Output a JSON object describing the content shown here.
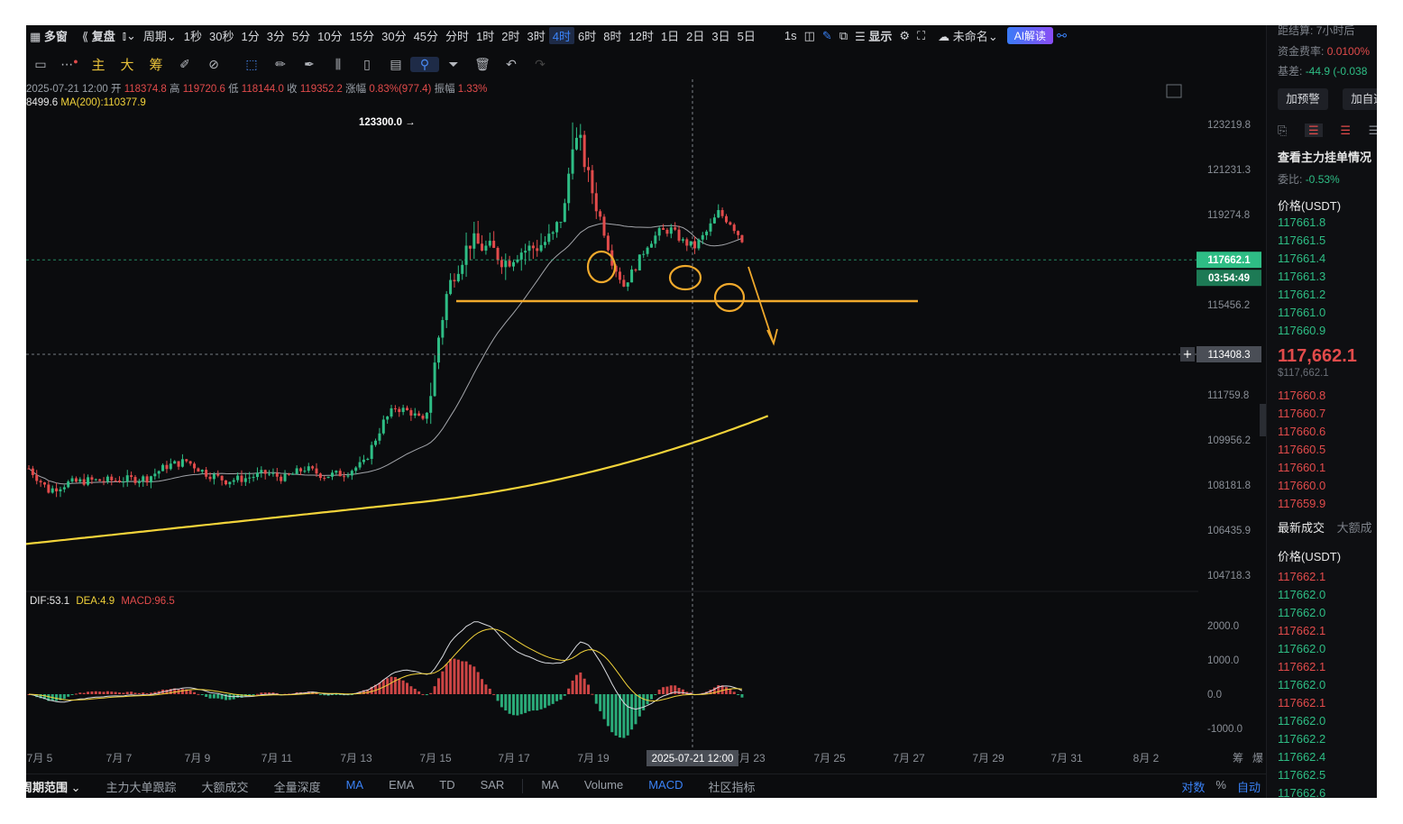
{
  "topbar": {
    "layout_label": "多窗",
    "replay_label": "复盘",
    "period_label": "周期",
    "intervals": [
      "1秒",
      "30秒",
      "1分",
      "3分",
      "5分",
      "10分",
      "15分",
      "30分",
      "45分",
      "分时",
      "1时",
      "2时",
      "3时",
      "4时",
      "6时",
      "8时",
      "12时",
      "1日",
      "2日",
      "3日",
      "5日"
    ],
    "active_interval": "4时",
    "second_label": "1s",
    "display_label": "显示",
    "cloud_label": "未命名",
    "ai_label": "AI解读"
  },
  "toolbar": {
    "keys": [
      "主",
      "大",
      "筹"
    ]
  },
  "ohlc": {
    "date": "2025-07-21 12:00",
    "open_label": "开",
    "open": "118374.8",
    "high_label": "高",
    "high": "119720.6",
    "low_label": "低",
    "low": "118144.0",
    "close_label": "收",
    "close": "119352.2",
    "change_label": "涨幅",
    "change": "0.83%(977.4)",
    "amp_label": "振幅",
    "amp": "1.33%"
  },
  "ma": {
    "ma_short": "8499.6",
    "ma200": "MA(200):110377.9"
  },
  "macd_labels": {
    "dif": "DIF:53.1",
    "dea": "DEA:4.9",
    "macd": "MACD:96.5"
  },
  "annotations": {
    "high_label": "123300.0 →"
  },
  "price_axis": [
    "123219.8",
    "121231.3",
    "119274.8",
    "115456.2",
    "111759.8",
    "109956.2",
    "108181.8",
    "106435.9",
    "104718.3"
  ],
  "current_price_tag": "117662.1",
  "countdown_tag": "03:54:49",
  "crosshair_price_tag": "113408.3",
  "macd_axis": [
    "2000.0",
    "1000.0",
    "0.0",
    "-1000.0"
  ],
  "time_axis": [
    "7月 5",
    "7月 7",
    "7月 9",
    "7月 11",
    "7月 13",
    "7月 15",
    "7月 17",
    "7月 19",
    "7月 23",
    "7月 25",
    "7月 27",
    "7月 29",
    "7月 31",
    "8月 2"
  ],
  "crosshair_time": "2025-07-21 12:00",
  "time_axis_right": [
    "筹",
    "爆"
  ],
  "bottombar": {
    "range_label": "周期范围",
    "tools": [
      "主力大单跟踪",
      "大额成交",
      "全量深度",
      "MA",
      "EMA",
      "TD",
      "SAR"
    ],
    "indicators": [
      "MA",
      "Volume",
      "MACD",
      "社区指标"
    ],
    "right": [
      "对数",
      "%",
      "自动"
    ],
    "active": [
      "MA",
      "MACD"
    ]
  },
  "right_panel": {
    "settle_label": "距结算:",
    "settle_value": "7小时后",
    "funding_label": "资金费率:",
    "funding_value": "0.0100%",
    "basis_label": "基差:",
    "basis_value": "-44.9 (-0.038",
    "alert_button": "加预警",
    "add_button": "加自选",
    "whale_title": "查看主力挂单情况",
    "ratio_label": "委比:",
    "ratio_value": "-0.53%",
    "price_header": "价格(USDT)",
    "asks": [
      "117661.8",
      "117661.5",
      "117661.4",
      "117661.3",
      "117661.2",
      "117661.0",
      "117660.9"
    ],
    "last_price": "117,662.1",
    "last_price_usd": "$117,662.1",
    "bids": [
      "117660.8",
      "117660.7",
      "117660.6",
      "117660.5",
      "117660.1",
      "117660.0",
      "117659.9"
    ],
    "trades_tab1": "最新成交",
    "trades_tab2": "大额成",
    "trades_header": "价格(USDT)",
    "trades": [
      {
        "p": "117662.1",
        "side": "sell"
      },
      {
        "p": "117662.0",
        "side": "buy"
      },
      {
        "p": "117662.0",
        "side": "buy"
      },
      {
        "p": "117662.1",
        "side": "sell"
      },
      {
        "p": "117662.0",
        "side": "buy"
      },
      {
        "p": "117662.1",
        "side": "sell"
      },
      {
        "p": "117662.0",
        "side": "buy"
      },
      {
        "p": "117662.1",
        "side": "sell"
      },
      {
        "p": "117662.0",
        "side": "buy"
      },
      {
        "p": "117662.2",
        "side": "buy"
      },
      {
        "p": "117662.4",
        "side": "buy"
      },
      {
        "p": "117662.5",
        "side": "buy"
      },
      {
        "p": "117662.6",
        "side": "buy"
      }
    ]
  },
  "colors": {
    "up": "#2ebd85",
    "down": "#e24b4b",
    "ma200": "#f2d33a",
    "annotation": "#f0a92c",
    "accent": "#3a82f7"
  }
}
